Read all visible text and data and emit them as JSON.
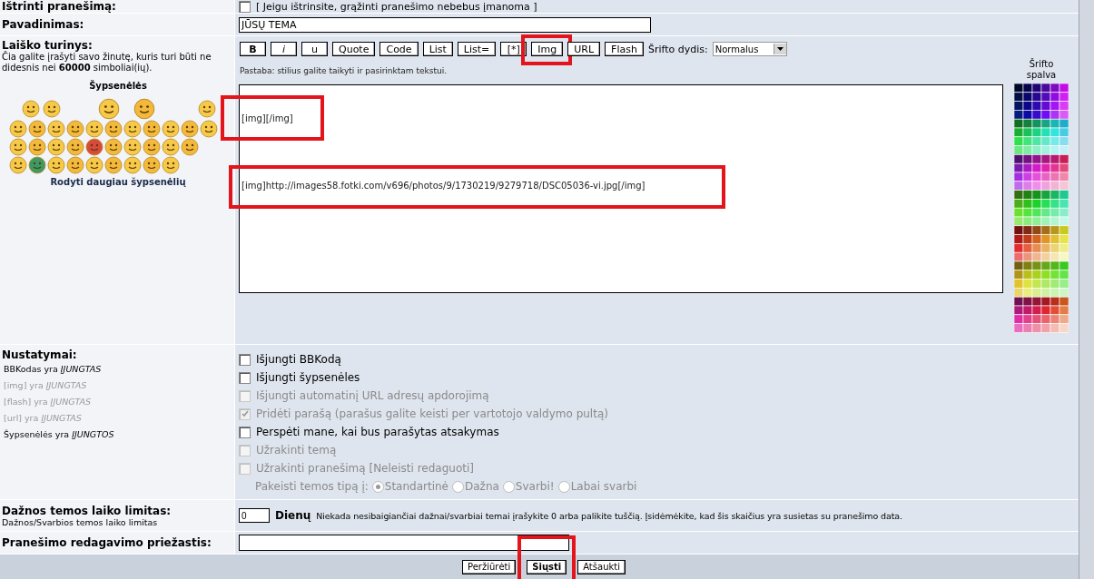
{
  "delete_row": {
    "label": "Ištrinti pranešimą:",
    "checked": false,
    "note": "[ Jeigu ištrinsite, grąžinti pranešimo nebebus įmanoma ]"
  },
  "subject": {
    "label": "Pavadinimas:",
    "value": "JŪSŲ TEMA"
  },
  "message": {
    "label": "Laiško turinys:",
    "hint": "Čia galite įrašyti savo žinutę, kuris turi būti ne didesnis nei **60000** simboliai(ių).",
    "smilies_title": "Šypsenėlės",
    "more_smilies": "Rodyti daugiau šypsenėlių",
    "toolbar": [
      {
        "label": "B",
        "kind": "bold"
      },
      {
        "label": "i",
        "kind": "italic"
      },
      {
        "label": "u",
        "kind": "plain"
      },
      {
        "label": "Quote",
        "kind": "plain"
      },
      {
        "label": "Code",
        "kind": "plain"
      },
      {
        "label": "List",
        "kind": "plain"
      },
      {
        "label": "List=",
        "kind": "plain"
      },
      {
        "label": "[*]",
        "kind": "plain"
      },
      {
        "label": "Img",
        "kind": "plain",
        "highlighted": true
      },
      {
        "label": "URL",
        "kind": "plain"
      },
      {
        "label": "Flash",
        "kind": "plain"
      }
    ],
    "font_size_label": "Šrifto dydis:",
    "font_size": "Normalus",
    "note": "Pastaba: stilius galite taikyti ir pasirinktam tekstui.",
    "lines": [
      {
        "text": "[img][/img]",
        "highlighted": true
      },
      {
        "text": "[img]http://images58.fotki.com/v696/photos/9/1730219/9279718/DSC05036-vi.jpg[/img]",
        "highlighted": true
      }
    ],
    "color_label": "Šrifto spalva"
  },
  "settings": {
    "label": "Nustatymai:",
    "statuses": [
      {
        "text": "BBKodas yra *ĮJUNGTAS*",
        "disabled": false
      },
      {
        "text": "[img] yra *ĮJUNGTAS*",
        "disabled": true
      },
      {
        "text": "[flash] yra *ĮJUNGTAS*",
        "disabled": true
      },
      {
        "text": "[url] yra *ĮJUNGTAS*",
        "disabled": true
      },
      {
        "text": "Šypsenėlės yra *ĮJUNGTOS*",
        "disabled": false
      }
    ],
    "options": [
      {
        "label": "Išjungti BBKodą",
        "checked": false,
        "disabled": false
      },
      {
        "label": "Išjungti šypsenėles",
        "checked": false,
        "disabled": false
      },
      {
        "label": "Išjungti automatinį URL adresų apdorojimą",
        "checked": false,
        "disabled": true
      },
      {
        "label": "Pridėti parašą (parašus galite keisti per vartotojo valdymo pultą)",
        "checked": true,
        "disabled": true
      },
      {
        "label": "Perspėti mane, kai bus parašytas atsakymas",
        "checked": false,
        "disabled": false
      },
      {
        "label": "Užrakinti temą",
        "checked": false,
        "disabled": true
      },
      {
        "label": "Užrakinti pranešimą [Neleisti redaguoti]",
        "checked": false,
        "disabled": true
      }
    ],
    "topic_type_label": "Pakeisti temos tipą į:",
    "topic_types": [
      {
        "label": "Standartinė",
        "selected": true
      },
      {
        "label": "Dažna",
        "selected": false
      },
      {
        "label": "Svarbi!",
        "selected": false
      },
      {
        "label": "Labai svarbi",
        "selected": false
      }
    ]
  },
  "limit": {
    "label": "Dažnos temos laiko limitas:",
    "sublabel": "Dažnos/Svarbios temos laiko limitas",
    "value": "0",
    "unit": "Dienų",
    "note": "Niekada nesibaigiančiai dažnai/svarbiai temai įrašykite 0 arba palikite tuščią. Įsidėmėkite, kad šis skaičius yra susietas su pranešimo data."
  },
  "reason": {
    "label": "Pranešimo redagavimo priežastis:"
  },
  "buttons": [
    {
      "label": "Peržiūrėti",
      "primary": false,
      "highlighted": false
    },
    {
      "label": "Siųsti",
      "primary": true,
      "highlighted": true
    },
    {
      "label": "Atšaukti",
      "primary": false,
      "highlighted": false
    }
  ]
}
